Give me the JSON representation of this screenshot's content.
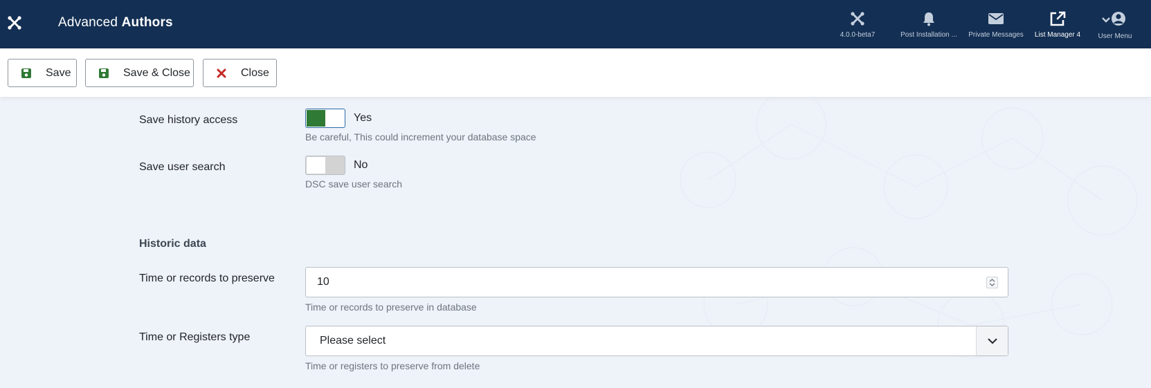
{
  "app": {
    "title_prefix": "Advanced",
    "title_strong": "Authors"
  },
  "header_items": [
    {
      "label": "4.0.0-beta7",
      "icon": "joomla-icon"
    },
    {
      "label": "Post Installation ...",
      "icon": "bell-icon"
    },
    {
      "label": "Private Messages",
      "icon": "envelope-icon"
    },
    {
      "label": "List Manager 4",
      "icon": "external-link-icon"
    },
    {
      "label": "User Menu",
      "icon": "user-circle-icon"
    }
  ],
  "toolbar": {
    "save_label": "Save",
    "save_close_label": "Save & Close",
    "close_label": "Close"
  },
  "fields": {
    "save_history": {
      "label": "Save history access",
      "state": "Yes",
      "description": "Be careful, This could increment your database space"
    },
    "save_user_search": {
      "label": "Save user search",
      "state": "No",
      "description": "DSC save user search"
    },
    "historic_section": "Historic data",
    "preserve": {
      "label": "Time or records to preserve",
      "value": "10",
      "description": "Time or records to preserve in database"
    },
    "registers_type": {
      "label": "Time or Registers type",
      "selected": "Please select",
      "description": "Time or registers to preserve from delete"
    }
  },
  "colors": {
    "header_bg": "#132f53",
    "switch_on": "#2f7a35",
    "save_icon": "#2f7a35",
    "close_icon": "#c52827",
    "page_bg": "#eef2f9"
  }
}
